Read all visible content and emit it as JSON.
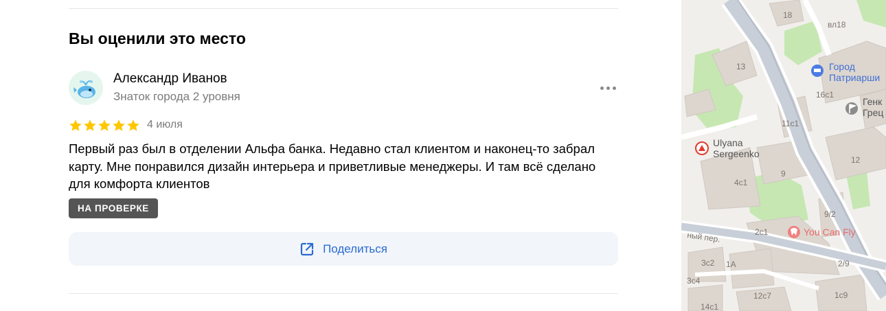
{
  "section": {
    "title": "Вы оценили это место"
  },
  "review": {
    "author_name": "Александр Иванов",
    "author_level": "Знаток города 2 уровня",
    "rating": 5,
    "date": "4 июля",
    "text": "Первый раз был в отделении Альфа банка. Недавно стал клиентом и наконец-то забрал карту. Мне понравился дизайн интерьера и приветливые менеджеры. И там всё сделано для комфорта клиентов",
    "status_badge": "НА ПРОВЕРКЕ"
  },
  "actions": {
    "share_label": "Поделиться"
  },
  "colors": {
    "star": "#ffc700",
    "accent": "#2a6bd2",
    "badge_bg": "#555555",
    "share_bg": "#f2f5fa"
  },
  "map": {
    "pois": {
      "hotel_line1": "Город",
      "hotel_line2": "Патриарши",
      "genk_line1": "Генк",
      "genk_line2": "Грец",
      "store_line1": "Ulyana",
      "store_line2": "Sergeenko",
      "dental": "You Can Fly"
    },
    "street": "ный пер.",
    "buildings": [
      "18",
      "вл18",
      "13",
      "16с1",
      "11с1",
      "12",
      "9",
      "4с1",
      "9/2",
      "2с1",
      "3с2",
      "1А",
      "2/9",
      "3с4",
      "12с7",
      "1с9",
      "14с1"
    ]
  }
}
